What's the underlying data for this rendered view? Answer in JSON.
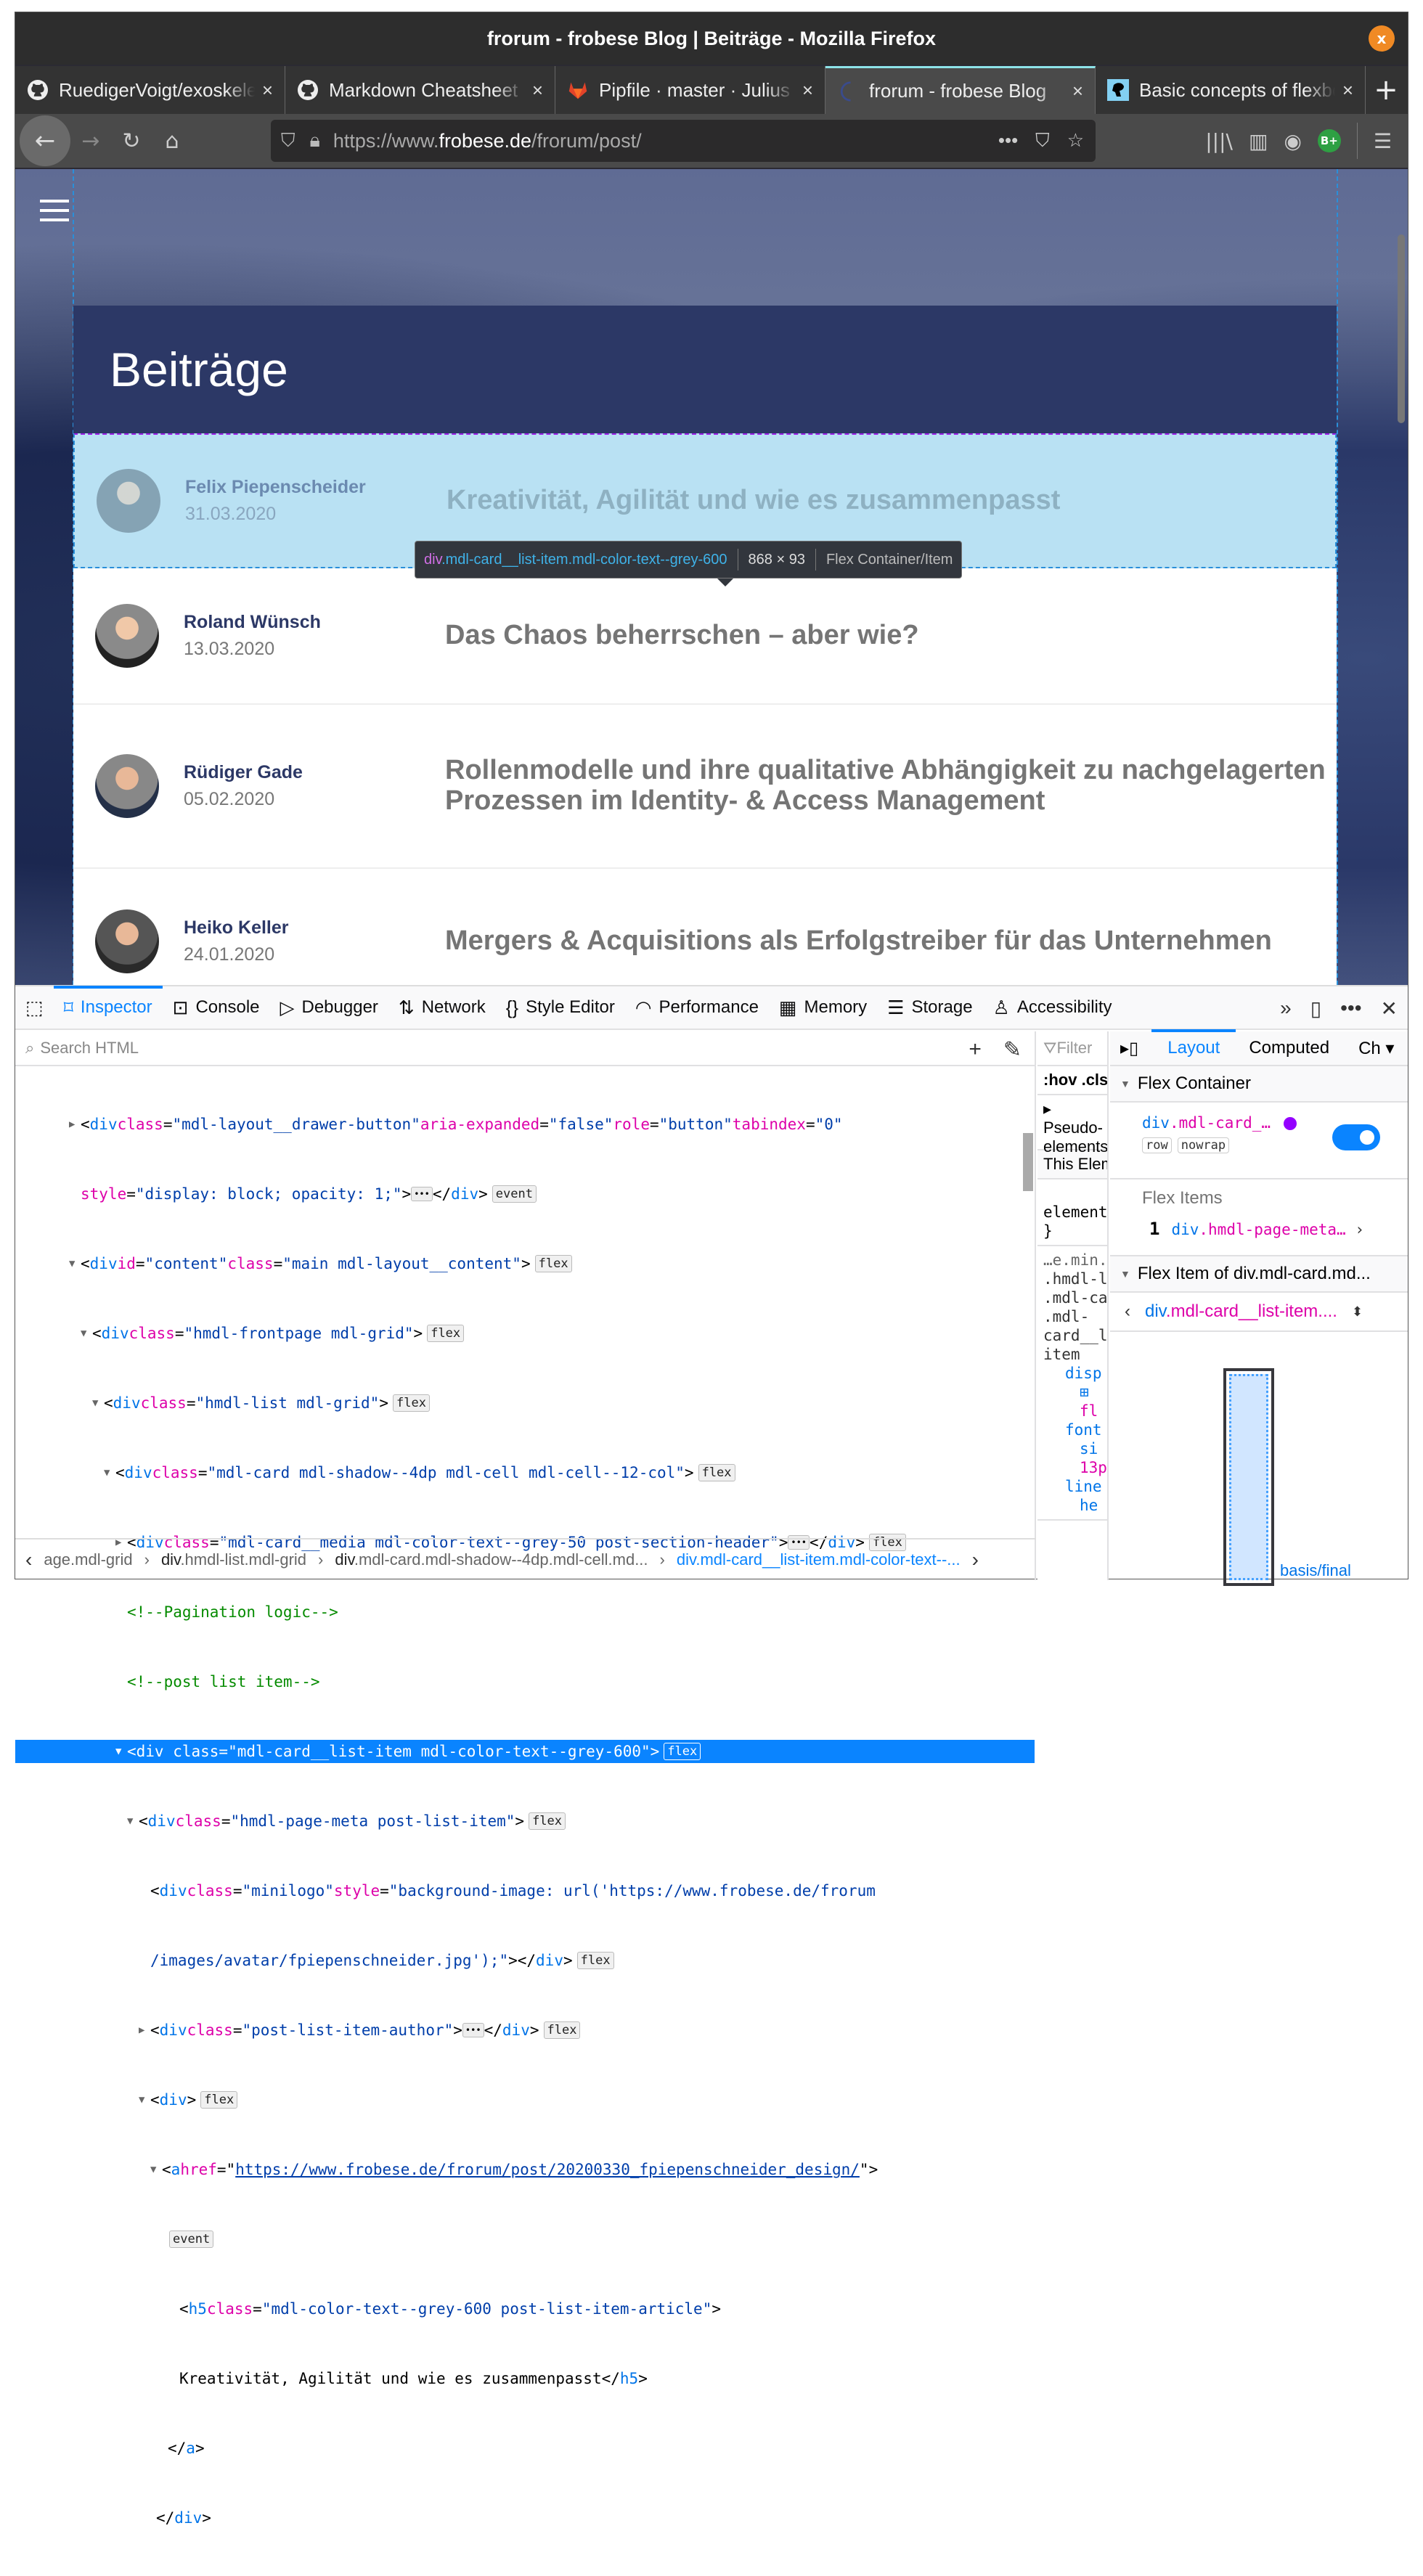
{
  "window": {
    "title": "frorum - frobese Blog | Beiträge - Mozilla Firefox",
    "close_label": "x"
  },
  "tabs": [
    {
      "label": "RuedigerVoigt/exoskeleton",
      "icon": "github-icon",
      "active": false
    },
    {
      "label": "Markdown Cheatsheet",
      "icon": "github-icon",
      "active": false
    },
    {
      "label": "Pipfile · master · Julius",
      "icon": "gitlab-icon",
      "active": false
    },
    {
      "label": "frorum - frobese Blog",
      "icon": "loading-icon",
      "active": true
    },
    {
      "label": "Basic concepts of flexbox",
      "icon": "mdn-icon",
      "active": false
    }
  ],
  "tab_close": "×",
  "new_tab": "+",
  "nav": {
    "url_prefix": "https://www.",
    "url_domain": "frobese.de",
    "url_path": "/frorum/post/",
    "more": "•••",
    "ext_badge": "B+"
  },
  "page": {
    "heading": "Beiträge",
    "posts": [
      {
        "author": "Felix Piepenscheider",
        "date": "31.03.2020",
        "title": "Kreativität, Agilität und wie es zusammenpasst",
        "highlighted": true
      },
      {
        "author": "Roland Wünsch",
        "date": "13.03.2020",
        "title": "Das Chaos beherrschen – aber wie?",
        "highlighted": false
      },
      {
        "author": "Rüdiger Gade",
        "date": "05.02.2020",
        "title": "Rollenmodelle und ihre qualitative Abhängigkeit zu nachgelagerten Prozessen im Identity- & Access Management",
        "highlighted": false
      },
      {
        "author": "Heiko Keller",
        "date": "24.01.2020",
        "title": "Mergers & Acquisitions als Erfolgstreiber für das Unternehmen",
        "highlighted": false
      }
    ]
  },
  "tooltip": {
    "tag": "div",
    "classes": ".mdl-card__list-item.mdl-color-text--grey-600",
    "size": "868 × 93",
    "type": "Flex Container/Item"
  },
  "devtools": {
    "tabs": [
      {
        "label": "Inspector",
        "icon": "inspector-icon",
        "active": true
      },
      {
        "label": "Console",
        "icon": "console-icon"
      },
      {
        "label": "Debugger",
        "icon": "debugger-icon"
      },
      {
        "label": "Network",
        "icon": "network-icon"
      },
      {
        "label": "Style Editor",
        "icon": "style-editor-icon"
      },
      {
        "label": "Performance",
        "icon": "performance-icon"
      },
      {
        "label": "Memory",
        "icon": "memory-icon"
      },
      {
        "label": "Storage",
        "icon": "storage-icon"
      },
      {
        "label": "Accessibility",
        "icon": "accessibility-icon"
      }
    ],
    "search_placeholder": "Search HTML",
    "tree": [
      "▶|<div class=\"mdl-layout__drawer-button\" aria-expanded=\"false\" role=\"button\" tabindex=\"0\"",
      "style=\"display: block; opacity: 1;\">…</div> [event]"
    ],
    "badges": {
      "flex": "flex",
      "event": "event"
    },
    "comments": {
      "pagination": "<!--Pagination logic-->",
      "post_list": "<!--post list item-->"
    },
    "link_href": "https://www.frobese.de/frorum/post/20200330_fpiepenschneider_design/",
    "image_url_1": "https://www.frobese.de/frorum",
    "image_url_2": "/images/avatar/fpiepenschneider.jpg",
    "h5_text": "Kreativität, Agilität und wie es zusammenpasst",
    "breadcrumbs": [
      {
        "tag": "",
        "cls": "age.mdl-grid"
      },
      {
        "tag": "div",
        "cls": ".hmdl-list.mdl-grid"
      },
      {
        "tag": "div",
        "cls": ".mdl-card.mdl-shadow--4dp.mdl-cell.md..."
      },
      {
        "tag": "div",
        "cls": ".mdl-card__list-item.mdl-color-text--..."
      }
    ],
    "rules": {
      "filter_placeholder": "Filter",
      "hov": ":hov",
      "cls": ".cls",
      "pseudo": "Pseudo-elements",
      "this_element": "This Element",
      "element_rule": "element {",
      "close_brace": "}",
      "source": "…e.min.",
      "selector_lines": [
        ".hmdl-l",
        ".mdl-ca",
        ".mdl-",
        "card__l",
        "item"
      ],
      "props": [
        "disp",
        "fl",
        "font",
        "si",
        "13p",
        "line",
        "he"
      ]
    },
    "layout": {
      "tabs": [
        "Layout",
        "Computed",
        "Ch"
      ],
      "flex_container_heading": "Flex Container",
      "container_selector_tag": "div",
      "container_selector_cls": ".mdl-card_…",
      "chips": [
        "row",
        "nowrap"
      ],
      "toggle_on": true,
      "flex_items_heading": "Flex Items",
      "flex_item_index": "1",
      "flex_item_tag": "div",
      "flex_item_cls": ".hmdl-page-meta…",
      "flex_item_of_heading": "Flex Item of div.mdl-card.md...",
      "item_nav_tag": "div",
      "item_nav_cls": ".mdl-card__list-item....",
      "basis_label": "basis/final"
    }
  }
}
